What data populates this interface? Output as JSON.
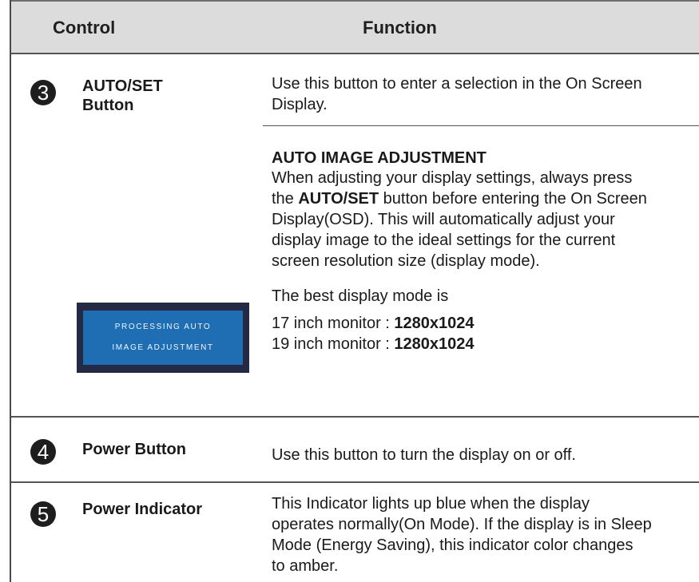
{
  "header": {
    "control": "Control",
    "function": "Function"
  },
  "rows": [
    {
      "number": "3",
      "control_line1": "AUTO/SET",
      "control_line2": "Button",
      "function_lines": [
        "Use this button to enter a selection in the On Screen",
        "Display."
      ]
    },
    {
      "subsection_title": "AUTO IMAGE ADJUSTMENT",
      "para_line1": "When adjusting your display settings, always press",
      "para_line2_prefix": "the ",
      "para_line2_bold": "AUTO/SET",
      "para_line2_suffix": " button before entering the On Screen",
      "para_line3": "Display(OSD). This will automatically adjust your",
      "para_line4": "display image to the ideal settings for the current",
      "para_line5": "screen resolution size (display mode).",
      "best_mode_intro": "The best display mode is",
      "monitor_17_label": "17 inch monitor : ",
      "monitor_17_value": "1280x1024",
      "monitor_19_label": "19 inch monitor : ",
      "monitor_19_value": "1280x1024",
      "osd_line1": "PROCESSING AUTO",
      "osd_line2": "IMAGE ADJUSTMENT",
      "osd_colors": {
        "frame": "#242a44",
        "panel": "#1f6db3"
      }
    },
    {
      "number": "4",
      "control": "Power Button",
      "function": "Use this button to turn the display on or off."
    },
    {
      "number": "5",
      "control": "Power Indicator",
      "function_lines": [
        "This Indicator lights up blue when the display",
        "operates normally(On Mode). If the display is in Sleep",
        "Mode (Energy Saving), this indicator color changes",
        "to amber."
      ]
    }
  ]
}
